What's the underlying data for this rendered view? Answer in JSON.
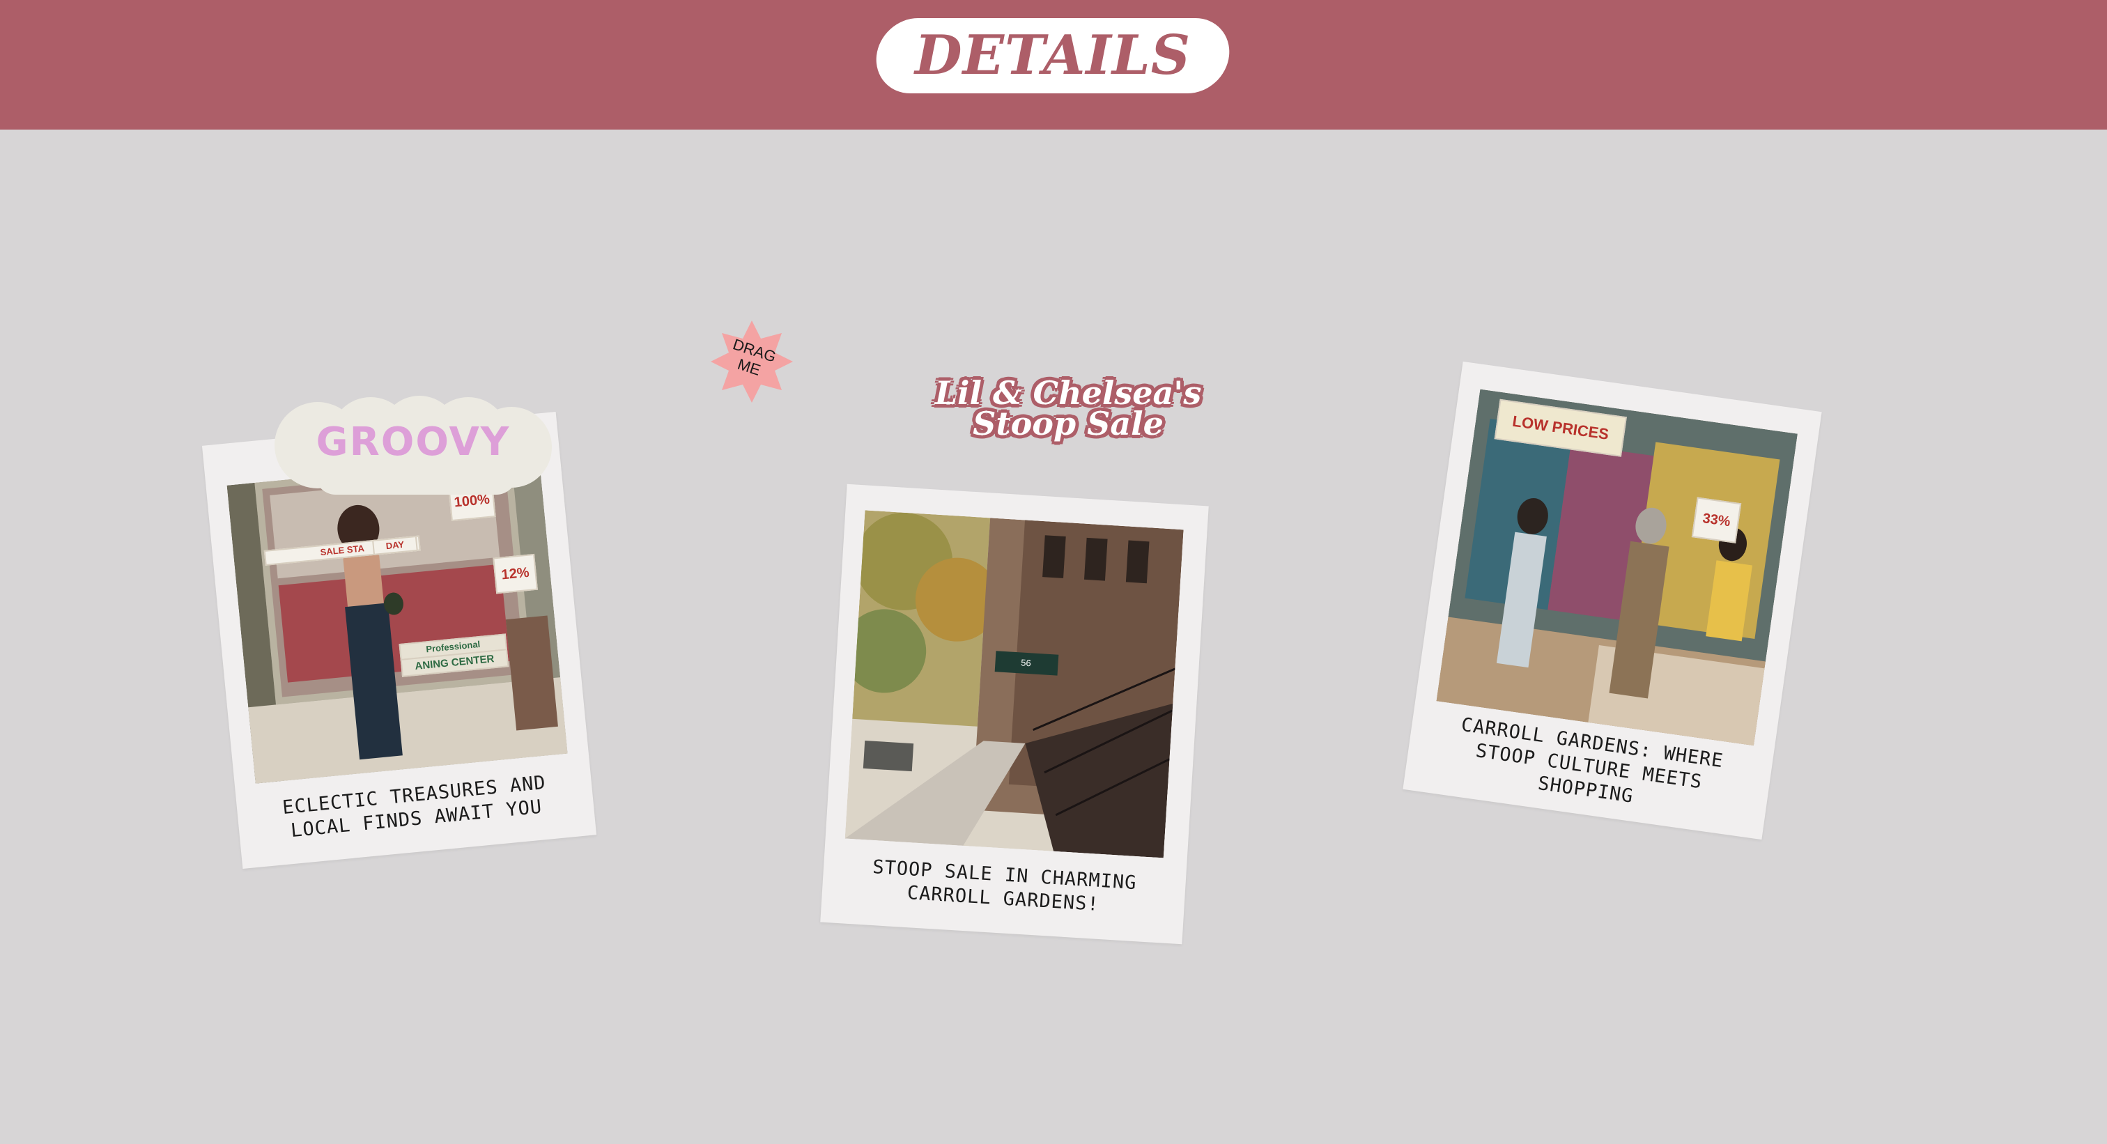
{
  "header": {
    "title": "DETAILS",
    "background_color": "#ad5e68"
  },
  "drag_badge": {
    "label": "DRAG\nME",
    "color": "#f4a3a3"
  },
  "brand": {
    "line1": "Lil & Chelsea's",
    "line2": "Stoop Sale"
  },
  "cards": [
    {
      "sticker": "GROOVY",
      "photo": {
        "description_icon": "storefront-photo",
        "signs": [
          "SALE STA",
          "DAY",
          "100%",
          "12%",
          "Professional",
          "ANING CENTER"
        ]
      },
      "caption": "ECLECTIC TREASURES AND LOCAL FINDS AWAIT YOU"
    },
    {
      "photo": {
        "description_icon": "brownstone-street-photo",
        "signs": [
          "56"
        ]
      },
      "caption": "STOOP SALE IN CHARMING CARROLL GARDENS!"
    },
    {
      "photo": {
        "description_icon": "fabric-store-photo",
        "signs": [
          "LOW PRICES",
          "33%"
        ]
      },
      "caption": "CARROLL GARDENS: WHERE STOOP CULTURE MEETS SHOPPING"
    }
  ]
}
